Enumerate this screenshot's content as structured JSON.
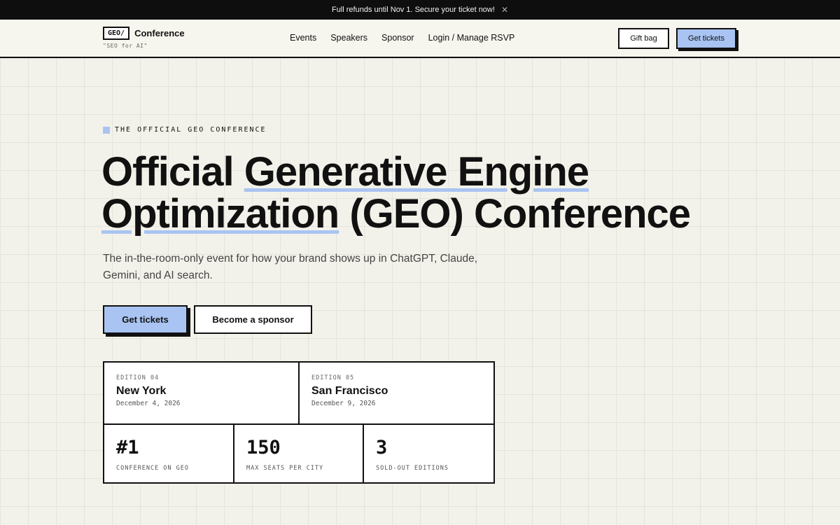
{
  "announcement": {
    "text": "Full refunds until Nov 1. Secure your ticket now!",
    "close_glyph": "✕"
  },
  "header": {
    "logo_mark": "GEO/",
    "logo_text": "Conference",
    "tagline": "\"SEO for AI\"",
    "nav": [
      {
        "label": "Events"
      },
      {
        "label": "Speakers"
      },
      {
        "label": "Sponsor"
      },
      {
        "label": "Login / Manage RSVP"
      }
    ],
    "gift_bag_label": "Gift bag",
    "get_tickets_label": "Get tickets"
  },
  "hero": {
    "eyebrow": "THE OFFICIAL GEO CONFERENCE",
    "headline": {
      "part1": "Official ",
      "part2": "Generative Engine",
      "part3": "Optimization",
      "part4": " (GEO) Conference"
    },
    "subtitle": "The in-the-room-only event for how your brand shows up in ChatGPT, Claude, Gemini, and AI search.",
    "cta_primary": "Get tickets",
    "cta_secondary": "Become a sponsor"
  },
  "editions": [
    {
      "label": "EDITION 04",
      "city": "New York",
      "date": "December 4, 2026"
    },
    {
      "label": "EDITION 05",
      "city": "San Francisco",
      "date": "December 9, 2026"
    }
  ],
  "metrics": [
    {
      "value": "#1",
      "label": "CONFERENCE ON GEO"
    },
    {
      "value": "150",
      "label": "MAX SEATS PER CITY"
    },
    {
      "value": "3",
      "label": "SOLD-OUT EDITIONS"
    }
  ],
  "colors": {
    "accent": "#a9c4f2",
    "background": "#f3f2ea",
    "ink": "#111111",
    "announcement_bg": "#0e0e0e"
  }
}
